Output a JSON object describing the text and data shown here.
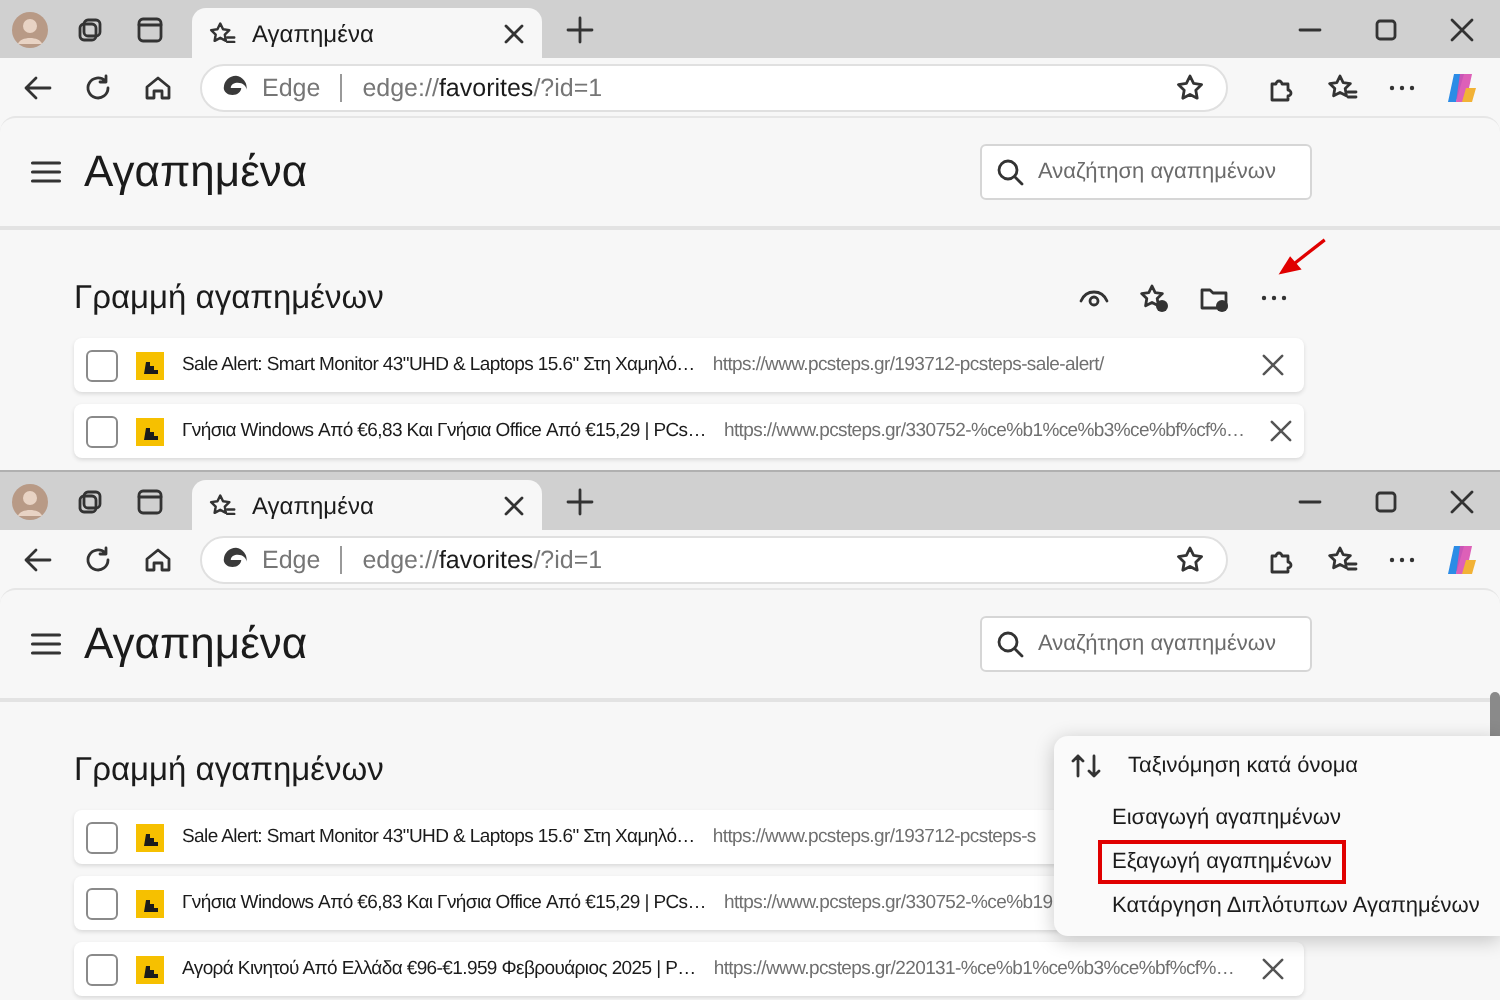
{
  "panels": [
    {
      "tab": {
        "title": "Αγαπημένα",
        "selected": true
      },
      "address": {
        "badge": "Edge",
        "scheme": "edge://",
        "host": "favorites",
        "path": "/?id=1"
      },
      "page_title": "Αγαπημένα",
      "search": {
        "placeholder": "Αναζήτηση αγαπημένων"
      },
      "section_title": "Γραμμή αγαπημένων",
      "annotation": {
        "kind": "arrow"
      },
      "rows": [
        {
          "checked": false,
          "title": "Sale Alert: Smart Monitor 43\"UHD & Laptops 15.6\" Στη Χαμηλό…",
          "url": "https://www.pcsteps.gr/193712-pcsteps-sale-alert/",
          "close": true
        },
        {
          "checked": false,
          "title": "Γνήσια Windows Από €6,83 Και Γνήσια Office Από €15,29 | PCs…",
          "url": "https://www.pcsteps.gr/330752-%ce%b1%ce%b3%ce%bf%cf%…",
          "close": true
        }
      ]
    },
    {
      "tab": {
        "title": "Αγαπημένα",
        "selected": true
      },
      "address": {
        "badge": "Edge",
        "scheme": "edge://",
        "host": "favorites",
        "path": "/?id=1"
      },
      "page_title": "Αγαπημένα",
      "search": {
        "placeholder": "Αναζήτηση αγαπημένων"
      },
      "section_title": "Γραμμή αγαπημένων",
      "rows": [
        {
          "checked": false,
          "title": "Sale Alert: Smart Monitor 43\"UHD & Laptops 15.6\" Στη Χαμηλό…",
          "url": "https://www.pcsteps.gr/193712-pcsteps-s",
          "close": false
        },
        {
          "checked": false,
          "title": "Γνήσια Windows Από €6,83 Και Γνήσια Office Από €15,29 | PCs…",
          "url": "https://www.pcsteps.gr/330752-%ce%b19",
          "close": false
        },
        {
          "checked": false,
          "title": "Αγορά Κινητού Από Ελλάδα €96-€1.959 Φεβρουάριος 2025 | P…",
          "url": "https://www.pcsteps.gr/220131-%ce%b1%ce%b3%ce%bf%cf%…",
          "close": true
        }
      ],
      "menu": [
        {
          "kind": "sort",
          "label": "Ταξινόμηση κατά όνομα",
          "highlighted": false
        },
        {
          "kind": "plain",
          "label": "Εισαγωγή αγαπημένων",
          "highlighted": false
        },
        {
          "kind": "plain",
          "label": "Εξαγωγή αγαπημένων",
          "highlighted": true
        },
        {
          "kind": "plain",
          "label": "Κατάργηση Διπλότυπων Αγαπημένων",
          "highlighted": false
        }
      ]
    }
  ]
}
